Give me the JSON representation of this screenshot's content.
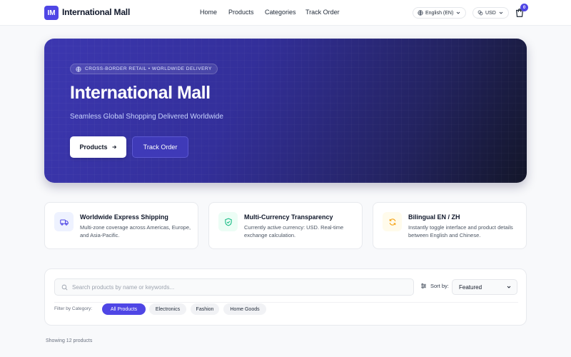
{
  "header": {
    "logo": "IM",
    "brand": "International Mall",
    "nav": [
      "Home",
      "Products",
      "Categories",
      "Track Order"
    ],
    "language": "English (EN)",
    "currency": "USD",
    "cart_count": "0"
  },
  "hero": {
    "tag": "CROSS-BORDER RETAIL • WORLDWIDE DELIVERY",
    "title": "International Mall",
    "subtitle": "Seamless Global Shopping Delivered Worldwide",
    "primary_button": "Products",
    "secondary_button": "Track Order"
  },
  "features": [
    {
      "title": "Worldwide Express Shipping",
      "desc": "Multi-zone coverage across Americas, Europe, and Asia-Pacific.",
      "icon": "truck-icon",
      "color": "#4f46e5"
    },
    {
      "title": "Multi-Currency Transparency",
      "desc": "Currently active currency: USD. Real-time exchange calculation.",
      "icon": "shield-check-icon",
      "color": "#10b981"
    },
    {
      "title": "Bilingual EN / ZH",
      "desc": "Instantly toggle interface and product details between English and Chinese.",
      "icon": "refresh-icon",
      "color": "#f59e0b"
    }
  ],
  "filters": {
    "search_placeholder": "Search products by name or keywords...",
    "sort_label": "Sort by:",
    "sort_value": "Featured",
    "category_label": "Filter by Category:",
    "categories": [
      "All Products",
      "Electronics",
      "Fashion",
      "Home Goods"
    ],
    "active_category": "All Products"
  },
  "results": {
    "count_text": "Showing 12 products"
  },
  "colors": {
    "accent": "#4f46e5"
  }
}
